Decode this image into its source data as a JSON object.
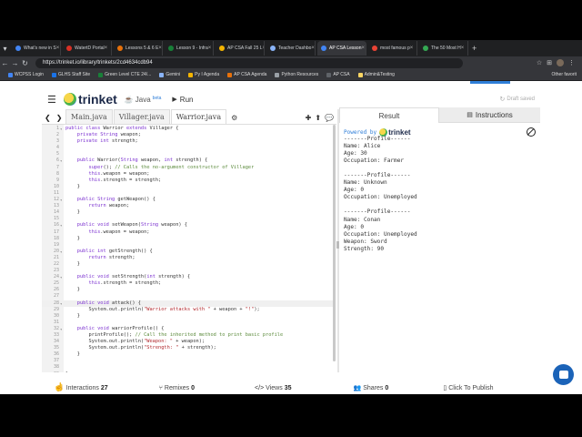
{
  "browser": {
    "tabs": [
      {
        "title": "What's new in S",
        "color": "#4285f4",
        "active": false
      },
      {
        "title": "WatertD Portal",
        "color": "#d93025",
        "active": false
      },
      {
        "title": "Lessons 5 & 6 E",
        "color": "#e8710a",
        "active": false
      },
      {
        "title": "Lesson 9 - Infra",
        "color": "#188038",
        "active": false
      },
      {
        "title": "AP CSA Fall 25 L",
        "color": "#f4b400",
        "active": false
      },
      {
        "title": "Teacher Dashbo",
        "color": "#8ab4f8",
        "active": false
      },
      {
        "title": "AP CSA Lesson",
        "color": "#4285f4",
        "active": true
      },
      {
        "title": "most famous p",
        "color": "#ea4335",
        "active": false
      },
      {
        "title": "The 50 Most H",
        "color": "#34a853",
        "active": false
      }
    ],
    "url": "https://trinket.io/library/trinkets/2cd4634cdb94",
    "bookmarks": [
      "WCPSS Login",
      "GLHS Staff Site",
      "Green Level CTE 24/...",
      "Gemini",
      "Py I Agenda",
      "AP CSA Agenda",
      "Python Resources",
      "AP CSA",
      "Admin&Testing"
    ],
    "bookmarks_other": "Other favorit"
  },
  "header": {
    "brand": "trinket",
    "language": "Java",
    "beta": "beta",
    "run_label": "Run",
    "draft_status": "Draft saved"
  },
  "editor": {
    "files": [
      "Main.java",
      "Villager.java",
      "Warrior.java"
    ],
    "active_file": 2,
    "highlight_line": 28,
    "lines": [
      [
        {
          "t": "public class ",
          "c": "kw"
        },
        {
          "t": "Warrior ",
          "c": ""
        },
        {
          "t": "extends ",
          "c": "kw"
        },
        {
          "t": "Villager {",
          "c": ""
        }
      ],
      [
        {
          "t": "    private ",
          "c": "kw"
        },
        {
          "t": "String ",
          "c": "ty"
        },
        {
          "t": "weapon;",
          "c": ""
        }
      ],
      [
        {
          "t": "    private ",
          "c": "kw"
        },
        {
          "t": "int ",
          "c": "ty"
        },
        {
          "t": "strength;",
          "c": ""
        }
      ],
      [],
      [],
      [
        {
          "t": "    public ",
          "c": "kw"
        },
        {
          "t": "Warrior(",
          "c": ""
        },
        {
          "t": "String ",
          "c": "ty"
        },
        {
          "t": "weapon, ",
          "c": ""
        },
        {
          "t": "int ",
          "c": "ty"
        },
        {
          "t": "strength) {",
          "c": ""
        }
      ],
      [
        {
          "t": "        super",
          "c": "kw"
        },
        {
          "t": "(); ",
          "c": ""
        },
        {
          "t": "// Calls the no-argument constructor of Villager",
          "c": "cm"
        }
      ],
      [
        {
          "t": "        this",
          "c": "kw"
        },
        {
          "t": ".weapon = weapon;",
          "c": ""
        }
      ],
      [
        {
          "t": "        this",
          "c": "kw"
        },
        {
          "t": ".strength = strength;",
          "c": ""
        }
      ],
      [
        {
          "t": "    }",
          "c": ""
        }
      ],
      [],
      [
        {
          "t": "    public ",
          "c": "kw"
        },
        {
          "t": "String ",
          "c": "ty"
        },
        {
          "t": "getWeapon() {",
          "c": ""
        }
      ],
      [
        {
          "t": "        return ",
          "c": "kw"
        },
        {
          "t": "weapon;",
          "c": ""
        }
      ],
      [
        {
          "t": "    }",
          "c": ""
        }
      ],
      [],
      [
        {
          "t": "    public ",
          "c": "kw"
        },
        {
          "t": "void ",
          "c": "ty"
        },
        {
          "t": "setWeapon(",
          "c": ""
        },
        {
          "t": "String ",
          "c": "ty"
        },
        {
          "t": "weapon) {",
          "c": ""
        }
      ],
      [
        {
          "t": "        this",
          "c": "kw"
        },
        {
          "t": ".weapon = weapon;",
          "c": ""
        }
      ],
      [
        {
          "t": "    }",
          "c": ""
        }
      ],
      [],
      [
        {
          "t": "    public ",
          "c": "kw"
        },
        {
          "t": "int ",
          "c": "ty"
        },
        {
          "t": "getStrength() {",
          "c": ""
        }
      ],
      [
        {
          "t": "        return ",
          "c": "kw"
        },
        {
          "t": "strength;",
          "c": ""
        }
      ],
      [
        {
          "t": "    }",
          "c": ""
        }
      ],
      [],
      [
        {
          "t": "    public ",
          "c": "kw"
        },
        {
          "t": "void ",
          "c": "ty"
        },
        {
          "t": "setStrength(",
          "c": ""
        },
        {
          "t": "int ",
          "c": "ty"
        },
        {
          "t": "strength) {",
          "c": ""
        }
      ],
      [
        {
          "t": "        this",
          "c": "kw"
        },
        {
          "t": ".strength = strength;",
          "c": ""
        }
      ],
      [
        {
          "t": "    }",
          "c": ""
        }
      ],
      [],
      [
        {
          "t": "    public ",
          "c": "kw"
        },
        {
          "t": "void ",
          "c": "ty"
        },
        {
          "t": "attack() {",
          "c": ""
        }
      ],
      [
        {
          "t": "        System.out.println(",
          "c": ""
        },
        {
          "t": "\"Warrior attacks with \"",
          "c": "st"
        },
        {
          "t": " + weapon + ",
          "c": ""
        },
        {
          "t": "\"!\"",
          "c": "st"
        },
        {
          "t": ");",
          "c": ""
        }
      ],
      [
        {
          "t": "    }",
          "c": ""
        }
      ],
      [],
      [
        {
          "t": "    public ",
          "c": "kw"
        },
        {
          "t": "void ",
          "c": "ty"
        },
        {
          "t": "warriorProfile() {",
          "c": ""
        }
      ],
      [
        {
          "t": "        printProfile(); ",
          "c": ""
        },
        {
          "t": "// Call the inherited method to print basic profile",
          "c": "cm"
        }
      ],
      [
        {
          "t": "        System.out.println(",
          "c": ""
        },
        {
          "t": "\"Weapon: \"",
          "c": "st"
        },
        {
          "t": " + weapon);",
          "c": ""
        }
      ],
      [
        {
          "t": "        System.out.println(",
          "c": ""
        },
        {
          "t": "\"Strength: \"",
          "c": "st"
        },
        {
          "t": " + strength);",
          "c": ""
        }
      ],
      [
        {
          "t": "    }",
          "c": ""
        }
      ],
      [],
      [],
      [
        {
          "t": "}",
          "c": ""
        }
      ]
    ]
  },
  "output": {
    "tab_result": "Result",
    "tab_instructions": "Instructions",
    "powered_by": "Powered by",
    "powered_brand": "trinket",
    "console": [
      "-------Profile------",
      "Name: Alice",
      "Age: 30",
      "Occupation: Farmer",
      "",
      "-------Profile------",
      "Name: Unknown",
      "Age: 0",
      "Occupation: Unemployed",
      "",
      "-------Profile------",
      "Name: Conan",
      "Age: 0",
      "Occupation: Unemployed",
      "Weapon: Sword",
      "Strength: 90"
    ]
  },
  "footer": {
    "interactions_label": "Interactions",
    "interactions_count": "27",
    "remixes_label": "Remixes",
    "remixes_count": "0",
    "views_label": "Views",
    "views_count": "35",
    "shares_label": "Shares",
    "shares_count": "0",
    "publish_label": "Click To Publish"
  }
}
